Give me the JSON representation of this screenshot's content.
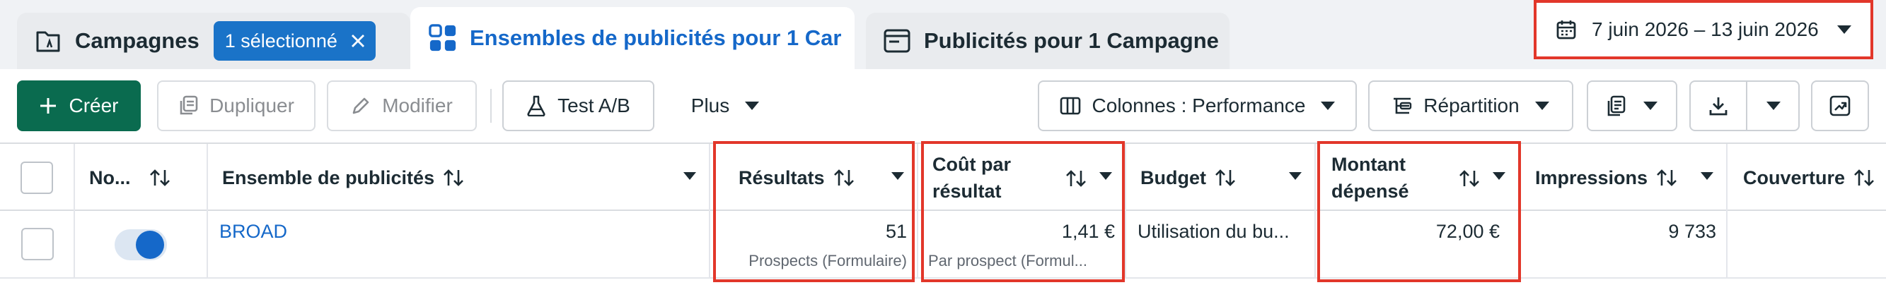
{
  "tabs": {
    "campagnes": {
      "label": "Campagnes",
      "selection_pill": "1 sélectionné"
    },
    "ensembles": {
      "label": "Ensembles de publicités pour 1 Car"
    },
    "publicites": {
      "label": "Publicités pour 1 Campagne"
    }
  },
  "date_range": "7 juin 2026 – 13 juin 2026",
  "toolbar": {
    "create": "Créer",
    "duplicate": "Dupliquer",
    "edit": "Modifier",
    "ab_test": "Test A/B",
    "more": "Plus",
    "columns": "Colonnes : Performance",
    "breakdown": "Répartition"
  },
  "table": {
    "headers": {
      "status": "No...",
      "adset": "Ensemble de publicités",
      "results": "Résultats",
      "cost_per_result": "Coût par résultat",
      "budget": "Budget",
      "amount_spent": "Montant dépensé",
      "impressions": "Impressions",
      "reach": "Couverture"
    },
    "rows": [
      {
        "name": "BROAD",
        "status_on": true,
        "results": "51",
        "results_sub": "Prospects (Formulaire)",
        "cost_per_result": "1,41 €",
        "cost_per_result_sub": "Par prospect (Formul...",
        "budget": "Utilisation du bu...",
        "amount_spent": "72,00 €",
        "impressions": "9 733",
        "reach": ""
      }
    ]
  },
  "colors": {
    "primary_blue": "#1568c9",
    "create_green": "#0a6b4f",
    "highlight_red": "#e2372a",
    "pill_blue": "#1a73c8"
  }
}
